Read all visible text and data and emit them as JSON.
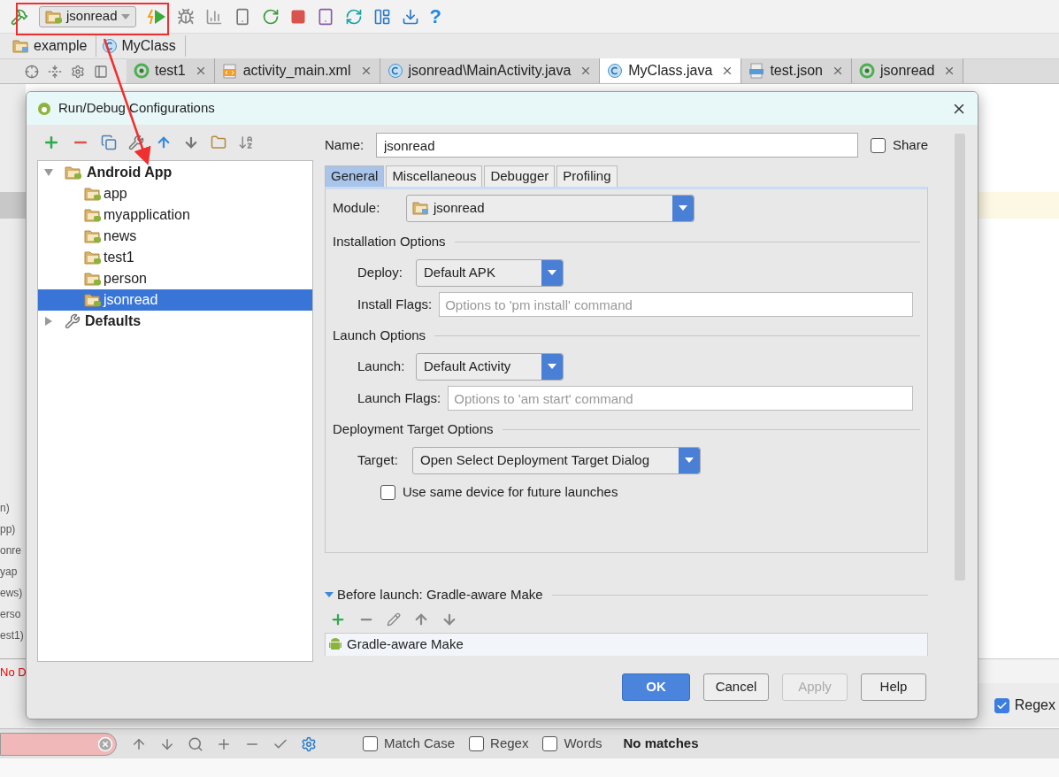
{
  "toolbar": {
    "run_config": "jsonread",
    "help": "?"
  },
  "breadcrumbs": [
    {
      "label": "example",
      "kind": "folder"
    },
    {
      "label": "MyClass",
      "kind": "class"
    }
  ],
  "editor_tabs": [
    {
      "label": "test1",
      "kind": "module",
      "selected": false
    },
    {
      "label": "activity_main.xml",
      "kind": "xml",
      "selected": false
    },
    {
      "label": "jsonread\\MainActivity.java",
      "kind": "class",
      "selected": false
    },
    {
      "label": "MyClass.java",
      "kind": "class",
      "selected": true
    },
    {
      "label": "test.json",
      "kind": "json",
      "selected": false
    },
    {
      "label": "jsonread",
      "kind": "module",
      "selected": false
    }
  ],
  "side_list": [
    "n)",
    "pp)",
    "onre",
    "yap",
    "ews)",
    "erso",
    "est1)"
  ],
  "error_text": "No D",
  "regex_option": {
    "label": "Regex",
    "checked": true
  },
  "find_bar": {
    "options": [
      {
        "label": "Match Case",
        "checked": false
      },
      {
        "label": "Regex",
        "checked": false
      },
      {
        "label": "Words",
        "checked": false
      }
    ],
    "status": "No matches"
  },
  "dialog": {
    "title": "Run/Debug Configurations",
    "tree": [
      {
        "label": "Android App",
        "expanded": true,
        "selected": false,
        "children": [
          {
            "label": "app",
            "selected": false
          },
          {
            "label": "myapplication",
            "selected": false
          },
          {
            "label": "news",
            "selected": false
          },
          {
            "label": "test1",
            "selected": false
          },
          {
            "label": "person",
            "selected": false
          },
          {
            "label": "jsonread",
            "selected": true
          }
        ]
      },
      {
        "label": "Defaults",
        "expanded": false,
        "selected": false
      }
    ],
    "name": {
      "label": "Name:",
      "value": "jsonread"
    },
    "share": {
      "label": "Share",
      "checked": false
    },
    "tabs": [
      {
        "label": "General",
        "selected": true
      },
      {
        "label": "Miscellaneous",
        "selected": false
      },
      {
        "label": "Debugger",
        "selected": false
      },
      {
        "label": "Profiling",
        "selected": false
      }
    ],
    "module": {
      "label": "Module:",
      "value": "jsonread"
    },
    "sections": [
      {
        "title": "Installation Options",
        "rows": [
          {
            "kind": "dropdown",
            "label": "Deploy:",
            "value": "Default APK"
          },
          {
            "kind": "input",
            "label": "Install Flags:",
            "placeholder": "Options to 'pm install' command"
          }
        ]
      },
      {
        "title": "Launch Options",
        "rows": [
          {
            "kind": "dropdown",
            "label": "Launch:",
            "value": "Default Activity"
          },
          {
            "kind": "input",
            "label": "Launch Flags:",
            "placeholder": "Options to 'am start' command"
          }
        ]
      },
      {
        "title": "Deployment Target Options",
        "rows": [
          {
            "kind": "wide_dropdown",
            "label": "Target:",
            "value": "Open Select Deployment Target Dialog"
          },
          {
            "kind": "checkbox",
            "label": "Use same device for future launches",
            "checked": false
          }
        ]
      }
    ],
    "before_launch": {
      "title": "Before launch: Gradle-aware Make",
      "expanded": true,
      "items": [
        "Gradle-aware Make"
      ]
    },
    "buttons": [
      {
        "label": "OK",
        "kind": "primary",
        "disabled": false
      },
      {
        "label": "Cancel",
        "kind": "normal",
        "disabled": false
      },
      {
        "label": "Apply",
        "kind": "normal",
        "disabled": true
      },
      {
        "label": "Help",
        "kind": "normal",
        "disabled": false
      }
    ]
  }
}
